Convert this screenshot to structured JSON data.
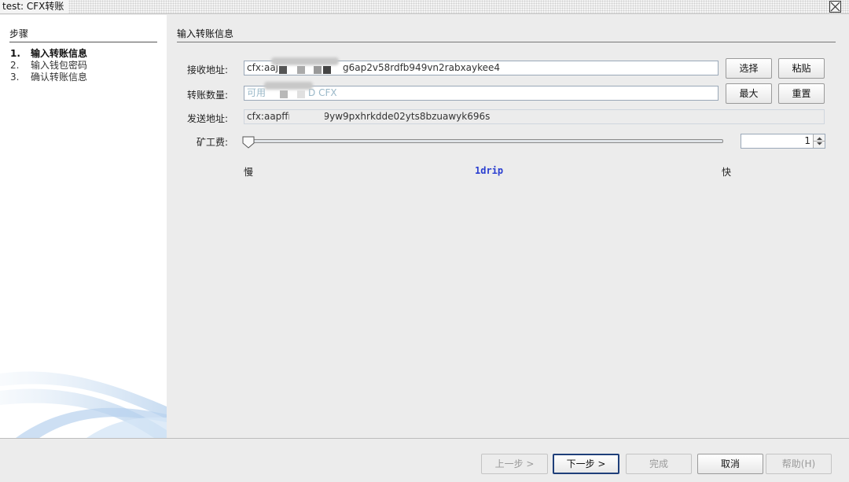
{
  "window": {
    "title": "test: CFX转账"
  },
  "steps": {
    "header": "步骤",
    "items": [
      {
        "num": "1.",
        "label": "输入转账信息"
      },
      {
        "num": "2.",
        "label": "输入钱包密码"
      },
      {
        "num": "3.",
        "label": "确认转账信息"
      }
    ]
  },
  "form": {
    "section_title": "输入转账信息",
    "receive": {
      "label": "接收地址:",
      "value_visible_start": "cfx:aaj",
      "value_visible_end": "g6ap2v58rdfb949vn2rabxaykee4",
      "select_button": "选择",
      "paste_button": "粘贴"
    },
    "amount": {
      "label": "转账数量:",
      "placeholder_start": "可用",
      "placeholder_end": "D CFX",
      "max_button": "最大",
      "reset_button": "重置"
    },
    "sender": {
      "label": "发送地址:",
      "value_visible_start": "cfx:aapffr",
      "value_visible_end": "9yw9pxhrkdde02yts8bzuawyk696s"
    },
    "fee": {
      "label": "矿工费:",
      "spinner_value": "1",
      "slow_label": "慢",
      "fast_label": "快",
      "unit_label": "1drip"
    }
  },
  "footer": {
    "prev": "上一步 >",
    "next": "下一步 >",
    "finish": "完成",
    "cancel": "取消",
    "help": "帮助(H)"
  }
}
